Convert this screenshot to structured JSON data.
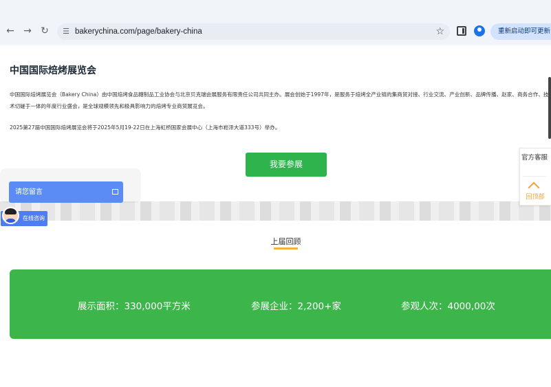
{
  "browser": {
    "url": "bakerychina.com/page/bakery-china",
    "update_label": "重新启动即可更新",
    "icons": [
      "back-arrow-icon",
      "forward-arrow-icon",
      "reload-icon",
      "site-settings-icon",
      "bookmark-star-icon",
      "side-panel-icon",
      "profile-icon"
    ]
  },
  "page": {
    "title": "中国国际焙烤展览会",
    "intro": "中国国际焙烤展览会（Bakery China）由中国焙烤食品糖制品工业协会与北京贝克瑞会展服务有限责任公司共同主办。展会创始于1997年，是服务于焙烤全产业链的集商贸对接、行业交流、产业创新、品牌传播、赵家、商务合作、技术切磋于一体的年度行业盛会，是全球规模领先和极具影响力的焙烤专业商贸展览会。",
    "event_info": "2025第27届中国国际焙烤展览会将于2025年5月19-22日在上海虹桥国家会展中心（上海市崧泽大道333号）举办。",
    "register_button": "我要参展",
    "section_title": "上届回顾"
  },
  "stats": [
    {
      "label": "展示面积：330,000平方米"
    },
    {
      "label": "参展企业：2,200+家"
    },
    {
      "label": "参观人次：4000,00次"
    }
  ],
  "widgets": {
    "message_label": "请您留言",
    "chat_label": "在线咨询",
    "official_label": "官方客服",
    "back_to_top_label": "回顶部"
  },
  "colors": {
    "accent_green": "#3cb64a",
    "button_green": "#2fb34d",
    "underline_gold": "#f2b636",
    "widget_blue": "#5b8cf5"
  }
}
